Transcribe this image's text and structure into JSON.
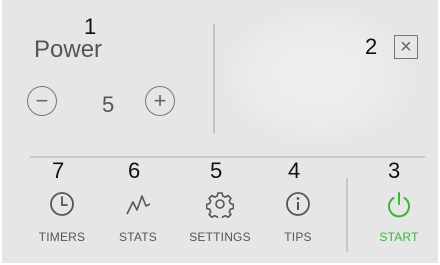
{
  "markers": [
    "1",
    "2",
    "3",
    "4",
    "5",
    "6",
    "7"
  ],
  "power": {
    "label": "Power",
    "value": "5",
    "decrement_symbol": "−",
    "increment_symbol": "+"
  },
  "close_symbol": "×",
  "nav": {
    "timers": "TIMERS",
    "stats": "STATS",
    "settings": "SETTINGS",
    "tips": "TIPS",
    "start": "START"
  },
  "colors": {
    "panel": "#e6e6e6",
    "text": "#555555",
    "accent": "#35b83a"
  },
  "icons": [
    "clock-icon",
    "stats-chart-icon",
    "gear-icon",
    "info-icon",
    "power-icon"
  ]
}
